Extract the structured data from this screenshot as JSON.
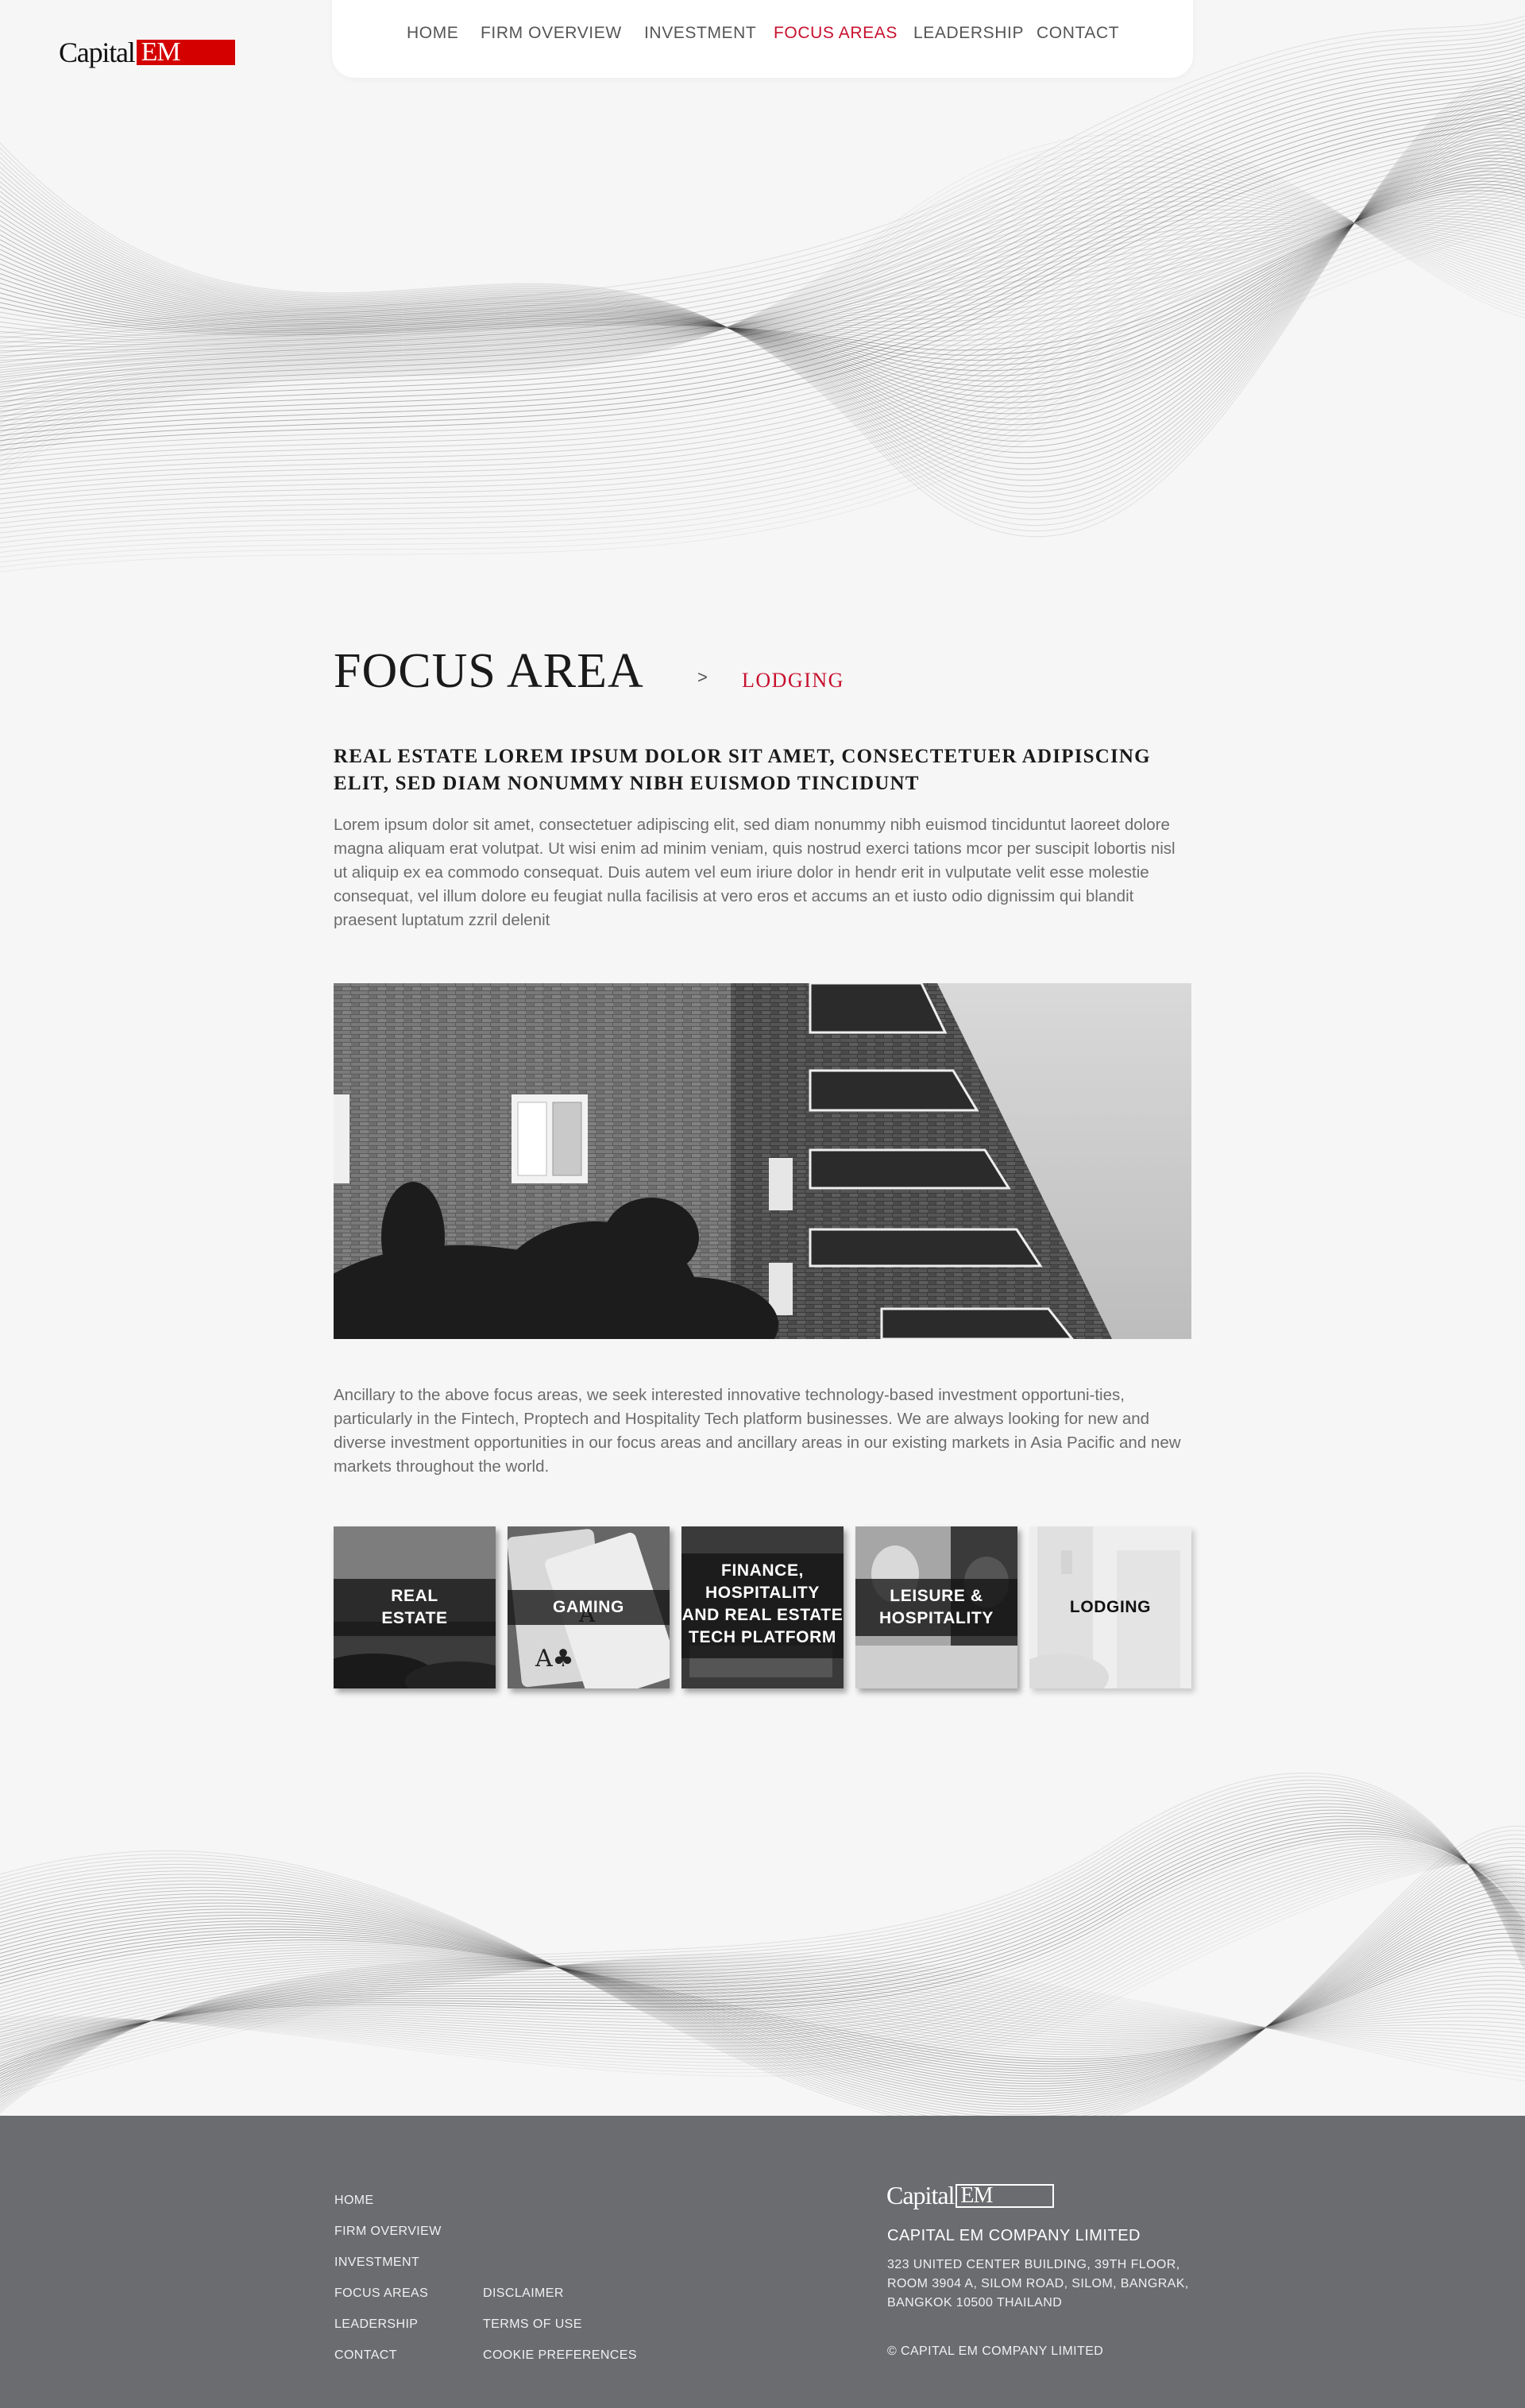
{
  "header": {
    "logo_word": "Capital",
    "logo_em": "EM",
    "nav": [
      {
        "label": "HOME",
        "active": false
      },
      {
        "label": "FIRM OVERVIEW",
        "active": false
      },
      {
        "label": "INVESTMENT",
        "active": false
      },
      {
        "label": "FOCUS AREAS",
        "active": true
      },
      {
        "label": "LEADERSHIP",
        "active": false
      },
      {
        "label": "CONTACT",
        "active": false
      }
    ]
  },
  "breadcrumb": {
    "title": "FOCUS AREA",
    "separator": ">",
    "current": "LODGING"
  },
  "main": {
    "heading": "REAL ESTATE LOREM IPSUM DOLOR SIT AMET, CONSECTETUER ADIPISCING ELIT, SED DIAM NONUMMY NIBH EUISMOD TINCIDUNT",
    "intro": "Lorem ipsum dolor sit amet, consectetuer adipiscing elit, sed diam nonummy nibh euismod tinciduntut laoreet dolore magna aliquam erat volutpat. Ut wisi enim ad minim veniam, quis nostrud exerci tations mcor per suscipit lobortis nisl ut aliquip ex ea commodo consequat. Duis autem vel eum iriure dolor in hendr erit in vulputate velit esse molestie consequat, vel illum dolore eu feugiat nulla facilisis at vero eros et accums an et iusto odio dignissim qui blandit praesent luptatum zzril delenit",
    "ancillary": "Ancillary to the above focus areas, we seek interested innovative technology-based investment opportuni-ties, particularly in the Fintech, Proptech and Hospitality Tech platform businesses. We are always looking for new and diverse investment opportunities in our focus areas and ancillary areas in our existing markets in Asia Pacific and new markets throughout the world."
  },
  "tiles": [
    {
      "label": "REAL\nESTATE"
    },
    {
      "label": "GAMING"
    },
    {
      "label": "FINANCE,\nHOSPITALITY\nAND REAL ESTATE\nTECH PLATFORM"
    },
    {
      "label": "LEISURE  &\nHOSPITALITY"
    },
    {
      "label": "LODGING"
    }
  ],
  "footer": {
    "nav_col1": [
      "HOME",
      "FIRM OVERVIEW",
      "INVESTMENT",
      "FOCUS AREAS",
      "LEADERSHIP",
      "CONTACT"
    ],
    "nav_col2": [
      "DISCLAIMER",
      "TERMS OF USE",
      "COOKIE PREFERENCES"
    ],
    "logo_word": "Capital",
    "logo_em": "EM",
    "company": "CAPITAL EM COMPANY LIMITED",
    "address": "323 UNITED CENTER BUILDING, 39TH FLOOR, ROOM 3904 A, SILOM ROAD, SILOM, BANGRAK, BANGKOK 10500 THAILAND",
    "copyright": "© CAPITAL EM COMPANY LIMITED"
  }
}
